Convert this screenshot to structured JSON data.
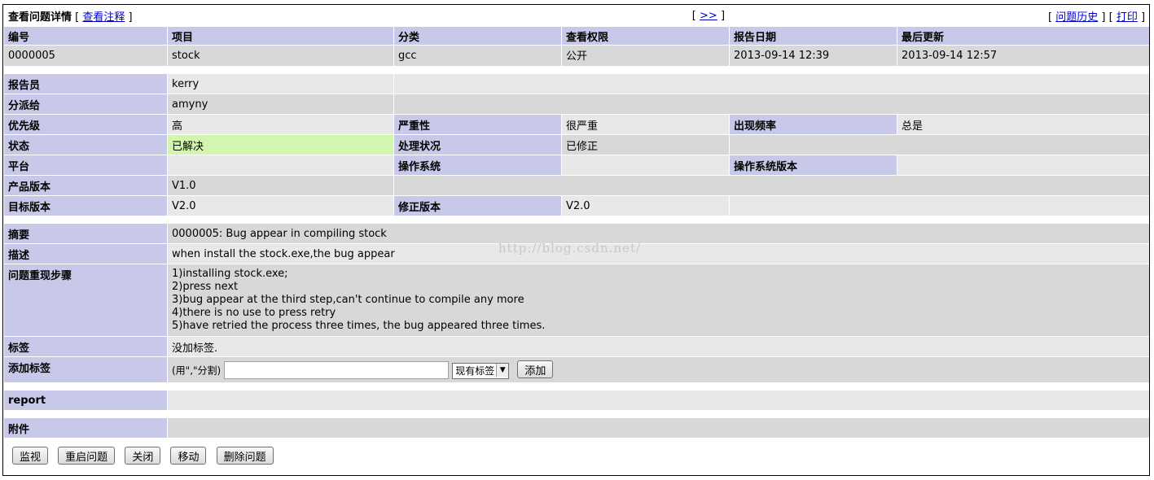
{
  "header": {
    "title": "查看问题详情",
    "view_notes_link": "查看注释",
    "next_link": ">>",
    "history_link": "问题历史",
    "print_link": "打印"
  },
  "columns": [
    "编号",
    "项目",
    "分类",
    "查看权限",
    "报告日期",
    "最后更新"
  ],
  "issue": {
    "id": "0000005",
    "project": "stock",
    "category": "gcc",
    "view_status": "公开",
    "date_submitted": "2013-09-14 12:39",
    "last_updated": "2013-09-14 12:57"
  },
  "labels": {
    "reporter": "报告员",
    "assigned_to": "分派给",
    "priority": "优先级",
    "severity": "严重性",
    "reproducibility": "出现频率",
    "status": "状态",
    "resolution": "处理状况",
    "platform": "平台",
    "os": "操作系统",
    "os_version": "操作系统版本",
    "product_version": "产品版本",
    "target_version": "目标版本",
    "fixed_in_version": "修正版本",
    "summary": "摘要",
    "description": "描述",
    "steps": "问题重现步骤",
    "tags": "标签",
    "add_tags": "添加标签",
    "report": "report",
    "attachments": "附件"
  },
  "values": {
    "reporter": "kerry",
    "assigned_to": "amyny",
    "priority": "高",
    "severity": "很严重",
    "reproducibility": "总是",
    "status": "已解决",
    "resolution": "已修正",
    "platform": "",
    "os": "",
    "os_version": "",
    "product_version": "V1.0",
    "target_version": "V2.0",
    "fixed_in_version": "V2.0",
    "summary": "0000005: Bug appear in compiling stock",
    "description": "when install the stock.exe,the bug appear",
    "steps": [
      "1)installing stock.exe;",
      "2)press next",
      "3)bug appear at the third step,can't continue to compile any more",
      "4)there is no use to press retry",
      "5)have retried the process three times, the bug appeared three times."
    ],
    "tags": "没加标签.",
    "tag_hint": "(用\",\"分割)",
    "tag_input_value": "",
    "tag_select": "现有标签",
    "add_button": "添加"
  },
  "buttons": {
    "monitor": "监视",
    "reopen": "重启问题",
    "close": "关闭",
    "move": "移动",
    "delete": "删除问题"
  },
  "watermark": "http://blog.csdn.net/",
  "colors": {
    "header_bg": "#c8c8e8",
    "row_light": "#e8e8e8",
    "row_dark": "#d8d8d8",
    "status_resolved": "#d2f5b0",
    "link": "#0000cc"
  }
}
